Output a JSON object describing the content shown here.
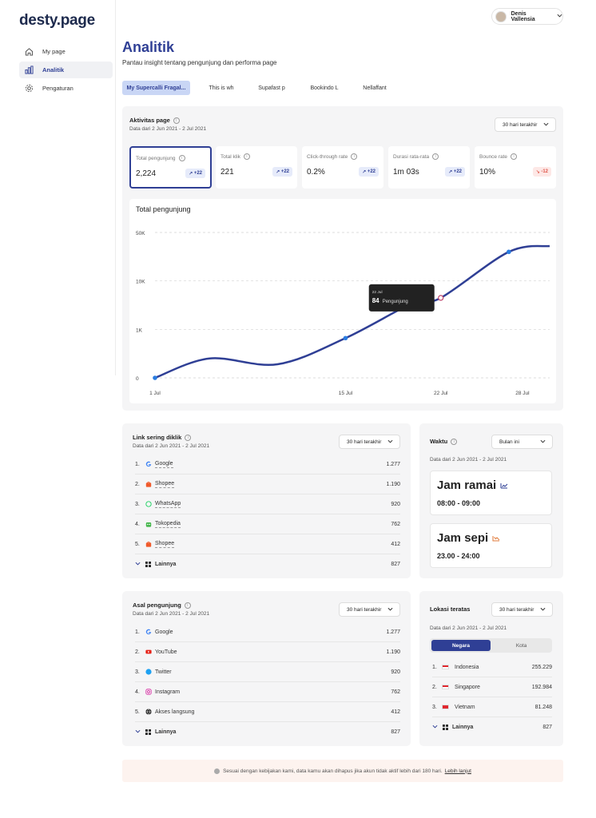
{
  "app": {
    "logo": "desty.page"
  },
  "sidebar": {
    "items": [
      {
        "label": "My page",
        "icon": "home-icon"
      },
      {
        "label": "Analitik",
        "icon": "chart-bar-icon"
      },
      {
        "label": "Pengaturan",
        "icon": "gear-icon"
      }
    ]
  },
  "user": {
    "name": "Denis Vallensia"
  },
  "page": {
    "title": "Analitik",
    "subtitle": "Pantau insight tentang pengunjung dan performa page"
  },
  "tabs": [
    "My Supercalli Fragal...",
    "This is wh",
    "Supafast p",
    "Bookindo L",
    "Nellaffant"
  ],
  "activity": {
    "title": "Aktivitas page",
    "date": "Data dari 2 Jun 2021 - 2 Jul 2021",
    "range": "30 hari terakhir",
    "stats": [
      {
        "label": "Total pengunjung",
        "value": "2,224",
        "change": "+22"
      },
      {
        "label": "Total klik",
        "value": "221",
        "change": "+22"
      },
      {
        "label": "Click-through rate",
        "value": "0.2%",
        "change": "+22"
      },
      {
        "label": "Durasi rata-rata",
        "value": "1m 03s",
        "change": "+22"
      },
      {
        "label": "Bounce rate",
        "value": "10%",
        "change": "-12"
      }
    ]
  },
  "chart_data": {
    "type": "line",
    "title": "Total pengunjung",
    "y_ticks": [
      "0",
      "1K",
      "10K",
      "50K"
    ],
    "x_ticks": [
      "1 Jul",
      "15 Jul",
      "22 Jul",
      "28 Jul"
    ],
    "series": [
      {
        "values": [
          0,
          0.4,
          0.28,
          0.82,
          1.55,
          1.65,
          2.6,
          2.72
        ]
      }
    ],
    "x": [
      "1 Jul",
      "5 Jul",
      "10 Jul",
      "15 Jul",
      "20 Jul",
      "22 Jul",
      "27 Jul",
      "30 Jul"
    ],
    "markers": [
      0,
      3,
      5,
      6
    ],
    "tooltip": {
      "date": "22 Jul",
      "value": "84",
      "unit": "Pengunjung"
    },
    "grid": true,
    "line_color": "#2f3f95"
  },
  "links": {
    "title": "Link sering diklik",
    "date": "Data dari 2 Jun 2021 - 2 Jul 2021",
    "range": "30 hari terakhir",
    "rows": [
      {
        "num": "1.",
        "name": "Google",
        "count": "1.277",
        "icon": "google-icon"
      },
      {
        "num": "2.",
        "name": "Shopee",
        "count": "1.190",
        "icon": "shopee-icon"
      },
      {
        "num": "3.",
        "name": "WhatsApp",
        "count": "920",
        "icon": "whatsapp-icon"
      },
      {
        "num": "4.",
        "name": "Tokopedia",
        "count": "762",
        "icon": "tokopedia-icon"
      },
      {
        "num": "5.",
        "name": "Shopee",
        "count": "412",
        "icon": "shopee-icon"
      }
    ],
    "more": {
      "label": "Lainnya",
      "count": "827"
    }
  },
  "waktu": {
    "title": "Waktu",
    "range": "Bulan ini",
    "date": "Data dari 2 Jun 2021 - 2 Jul 2021",
    "busy": {
      "label": "Jam ramai",
      "hours": "08:00 - 09:00"
    },
    "quiet": {
      "label": "Jam sepi",
      "hours": "23.00 - 24:00"
    }
  },
  "sources": {
    "title": "Asal pengunjung",
    "date": "Data dari 2 Jun 2021 - 2 Jul 2021",
    "range": "30 hari terakhir",
    "rows": [
      {
        "num": "1.",
        "name": "Google",
        "count": "1.277",
        "icon": "google-icon"
      },
      {
        "num": "2.",
        "name": "YouTube",
        "count": "1.190",
        "icon": "youtube-icon"
      },
      {
        "num": "3.",
        "name": "Twitter",
        "count": "920",
        "icon": "twitter-icon"
      },
      {
        "num": "4.",
        "name": "Instagram",
        "count": "762",
        "icon": "instagram-icon"
      },
      {
        "num": "5.",
        "name": "Akses langsung",
        "count": "412",
        "icon": "globe-icon"
      }
    ],
    "more": {
      "label": "Lainnya",
      "count": "827"
    }
  },
  "locations": {
    "title": "Lokasi teratas",
    "date": "Data dari 2 Jun 2021 - 2 Jul 2021",
    "range": "30 hari terakhir",
    "seg": {
      "on": "Negara",
      "off": "Kota"
    },
    "rows": [
      {
        "num": "1.",
        "name": "Indonesia",
        "count": "255.229"
      },
      {
        "num": "2.",
        "name": "Singapore",
        "count": "192.984"
      },
      {
        "num": "3.",
        "name": "Vietnam",
        "count": "81.248"
      }
    ],
    "more": {
      "label": "Lainnya",
      "count": "827"
    }
  },
  "footer": {
    "text": "Sesuai dengan kebijakan kami, data kamu akan dihapus jika akun tidak aktif lebih dari 180 hari.",
    "link": "Lebih lanjut"
  }
}
